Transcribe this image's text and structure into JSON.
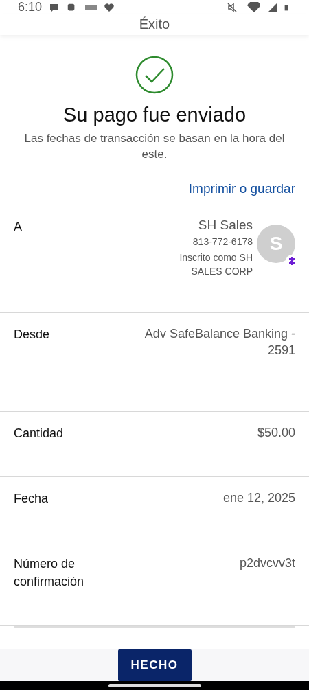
{
  "status_bar": {
    "time": "6:10"
  },
  "header": {
    "title": "Éxito"
  },
  "confirmation": {
    "title": "Su pago fue enviado",
    "note": "Las fechas de transacción se basan en la hora del este.",
    "link": "Imprimir o guardar"
  },
  "details": [
    {
      "kind": "recipient",
      "label": "A",
      "name": "SH Sales",
      "phone": "813-772-6178",
      "enrolled": "Inscrito como SH SALES CORP",
      "avatar": "S"
    },
    {
      "kind": "plain",
      "label": "Desde",
      "value": "Adv SafeBalance Banking - 2591"
    },
    {
      "kind": "plain",
      "label": "Cantidad",
      "value": "$50.00"
    },
    {
      "kind": "plain",
      "label": "Fecha",
      "value": "ene 12, 2025"
    },
    {
      "kind": "plain",
      "label": "Número de confirmación",
      "value": "p2dvcvv3t"
    }
  ],
  "footer": {
    "button": "HECHO"
  }
}
